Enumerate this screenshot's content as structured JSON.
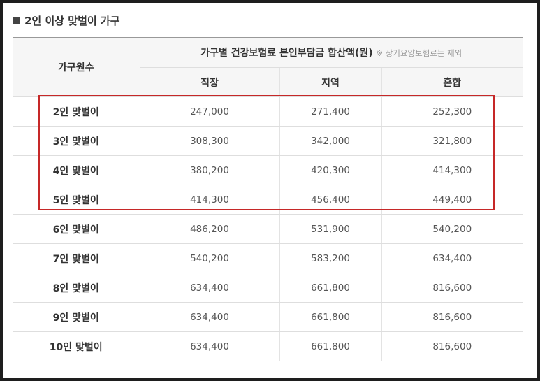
{
  "title": "2인 이상 맞벌이 가구",
  "table": {
    "header_household": "가구원수",
    "header_group": "가구별 건강보험료 본인부담금 합산액(원)",
    "header_note": "※ 장기요양보험료는 제외",
    "columns": [
      "직장",
      "지역",
      "혼합"
    ],
    "rows": [
      {
        "label": "2인 맞벌이",
        "values": [
          "247,000",
          "271,400",
          "252,300"
        ]
      },
      {
        "label": "3인 맞벌이",
        "values": [
          "308,300",
          "342,000",
          "321,800"
        ]
      },
      {
        "label": "4인 맞벌이",
        "values": [
          "380,200",
          "420,300",
          "414,300"
        ]
      },
      {
        "label": "5인 맞벌이",
        "values": [
          "414,300",
          "456,400",
          "449,400"
        ]
      },
      {
        "label": "6인 맞벌이",
        "values": [
          "486,200",
          "531,900",
          "540,200"
        ]
      },
      {
        "label": "7인 맞벌이",
        "values": [
          "540,200",
          "583,200",
          "634,400"
        ]
      },
      {
        "label": "8인 맞벌이",
        "values": [
          "634,400",
          "661,800",
          "816,600"
        ]
      },
      {
        "label": "9인 맞벌이",
        "values": [
          "634,400",
          "661,800",
          "816,600"
        ]
      },
      {
        "label": "10인 맞벌이",
        "values": [
          "634,400",
          "661,800",
          "816,600"
        ]
      }
    ]
  },
  "highlight": {
    "color": "#c62828"
  }
}
